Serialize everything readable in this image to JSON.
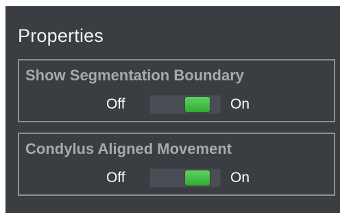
{
  "panel": {
    "title": "Properties"
  },
  "settings": [
    {
      "label": "Show Segmentation Boundary",
      "off_label": "Off",
      "on_label": "On",
      "state": "on",
      "accent": "#3cbf43"
    },
    {
      "label": "Condylus Aligned Movement",
      "off_label": "Off",
      "on_label": "On",
      "state": "on",
      "accent": "#3cbf43"
    }
  ]
}
